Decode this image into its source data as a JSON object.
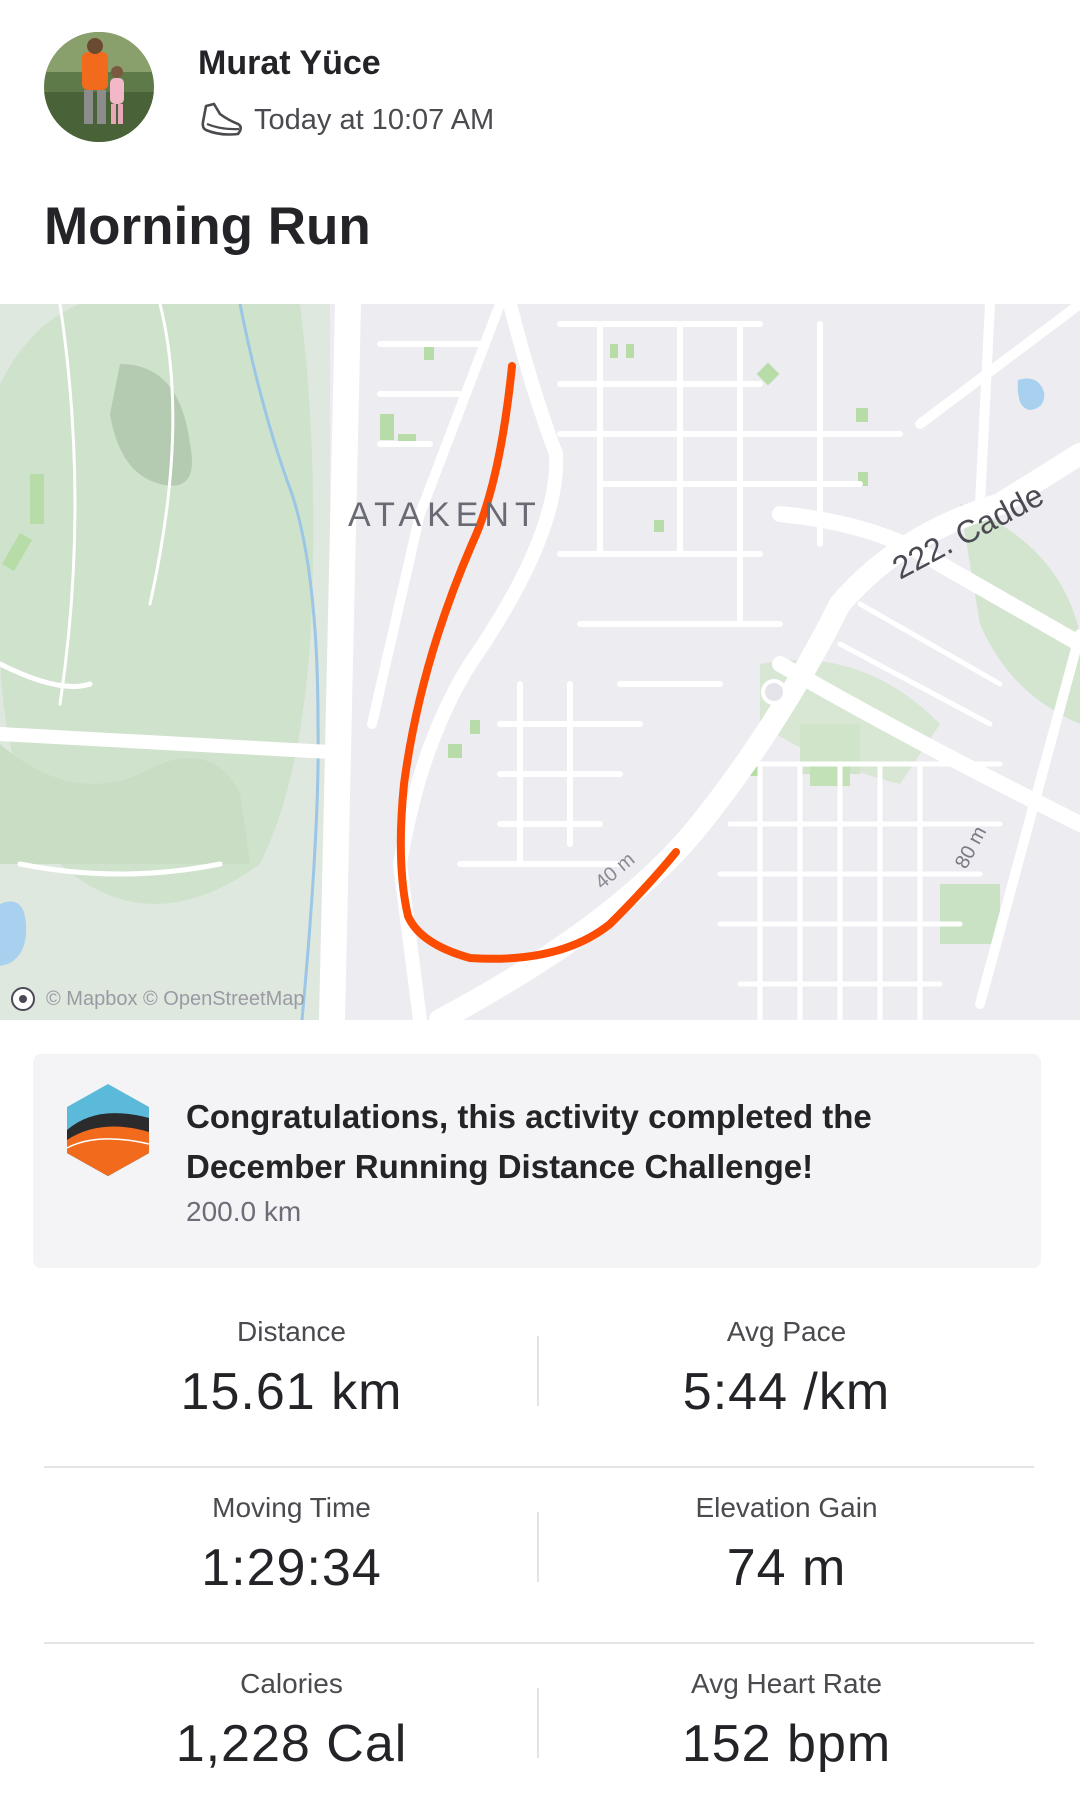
{
  "athlete": {
    "name": "Murat Yüce",
    "timestamp": "Today at 10:07 AM",
    "activity_icon": "running-shoe-icon"
  },
  "activity": {
    "title": "Morning Run"
  },
  "map": {
    "place_label": "ATAKENT",
    "street_label": "222. Cadde",
    "scale_label_1": "40 m",
    "scale_label_2": "80 m",
    "attribution": "© Mapbox © OpenStreetMap",
    "route_color": "#fc4c02"
  },
  "challenge": {
    "message": "Congratulations, this activity completed the December Running Distance Challenge!",
    "goal": "200.0 km",
    "badge_icon": "challenge-badge-icon"
  },
  "stats": [
    {
      "left": {
        "label": "Distance",
        "value": "15.61 km"
      },
      "right": {
        "label": "Avg Pace",
        "value": "5:44 /km"
      }
    },
    {
      "left": {
        "label": "Moving Time",
        "value": "1:29:34"
      },
      "right": {
        "label": "Elevation Gain",
        "value": "74 m"
      }
    },
    {
      "left": {
        "label": "Calories",
        "value": "1,228 Cal"
      },
      "right": {
        "label": "Avg Heart Rate",
        "value": "152 bpm"
      }
    }
  ]
}
